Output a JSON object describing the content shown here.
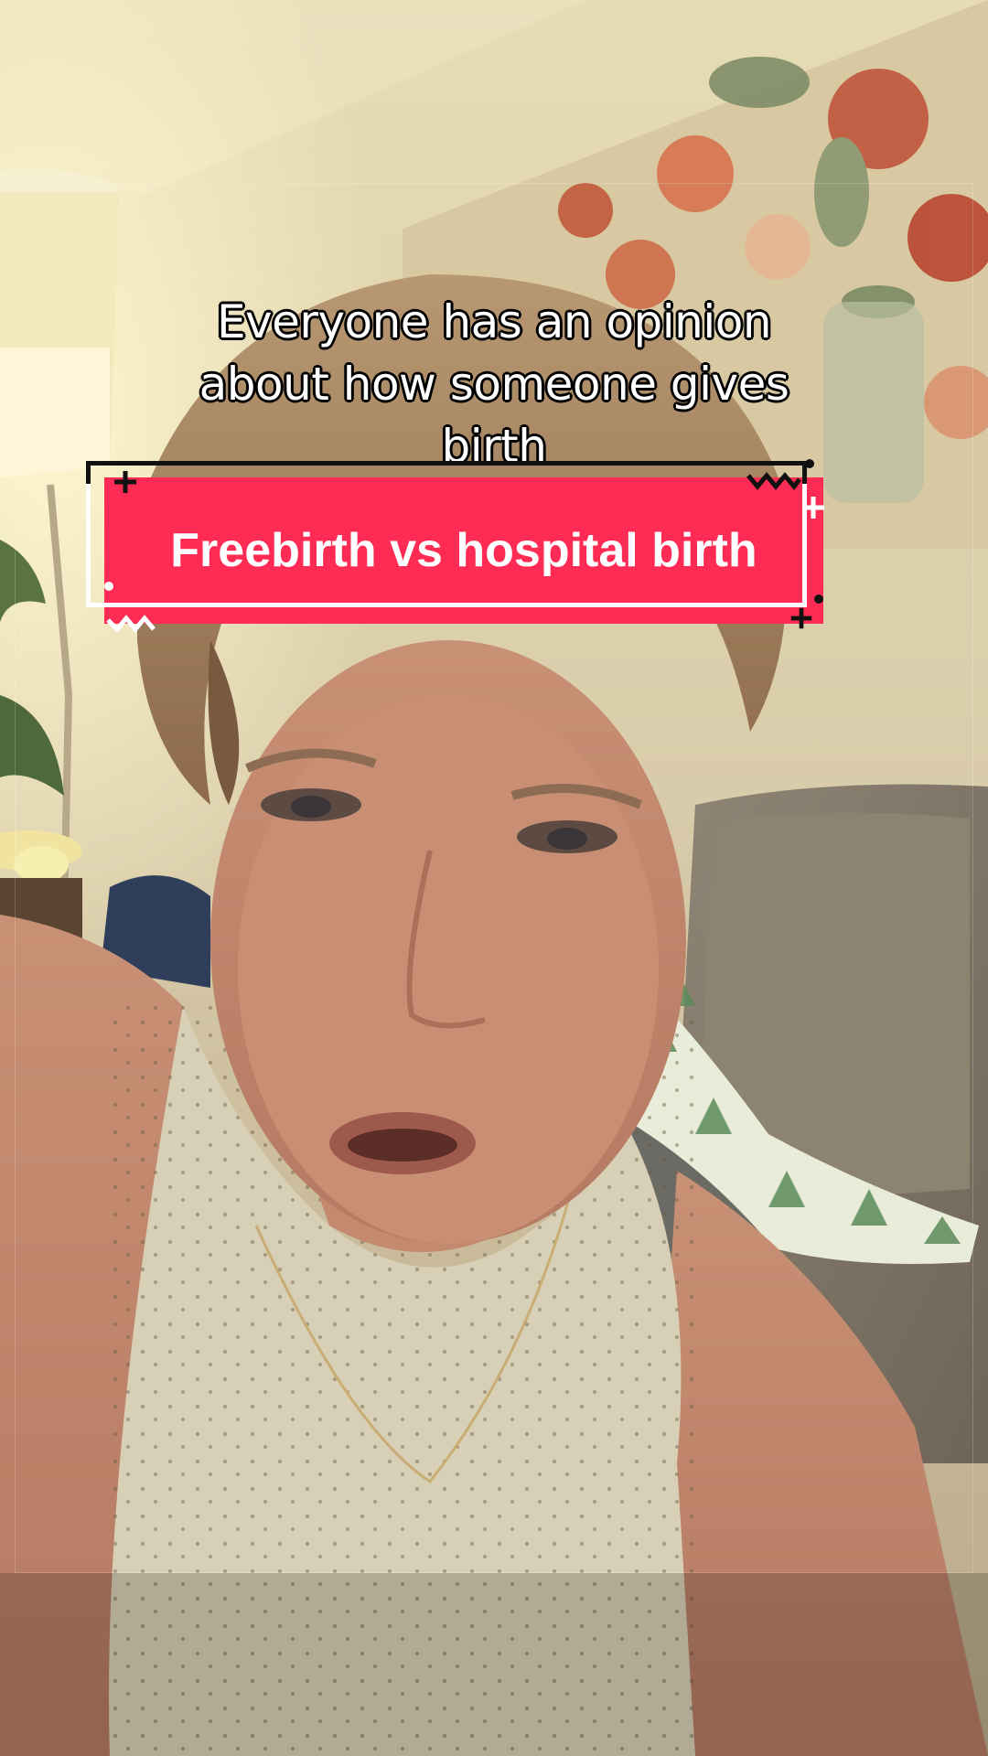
{
  "caption": {
    "line1": "Everyone has an opinion",
    "line2": "about how someone gives",
    "line3": "birth"
  },
  "sticker": {
    "text": "Freebirth vs hospital birth",
    "color": "#fe2c55"
  }
}
